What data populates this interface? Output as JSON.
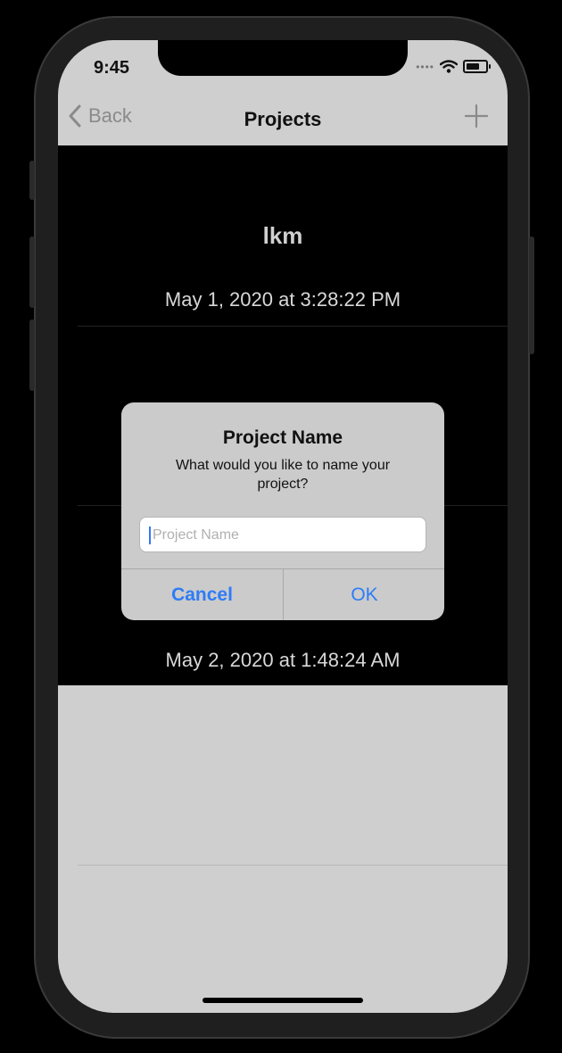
{
  "status_bar": {
    "time": "9:45",
    "signal_dots": "••••"
  },
  "nav": {
    "back_label": "Back",
    "title": "Projects",
    "add_icon": "plus-icon"
  },
  "projects": [
    {
      "name": "lkm",
      "date": "May 1, 2020 at 3:28:22 PM"
    },
    {
      "name": "",
      "date": "May 2, 2020 at 1:48:24 AM"
    }
  ],
  "alert": {
    "title": "Project Name",
    "message": "What would you like to name your project?",
    "input_placeholder": "Project Name",
    "input_value": "",
    "cancel_label": "Cancel",
    "ok_label": "OK"
  },
  "colors": {
    "accent": "#2e7cf6",
    "list_background": "#000000",
    "screen_background": "#cfcfcf"
  }
}
